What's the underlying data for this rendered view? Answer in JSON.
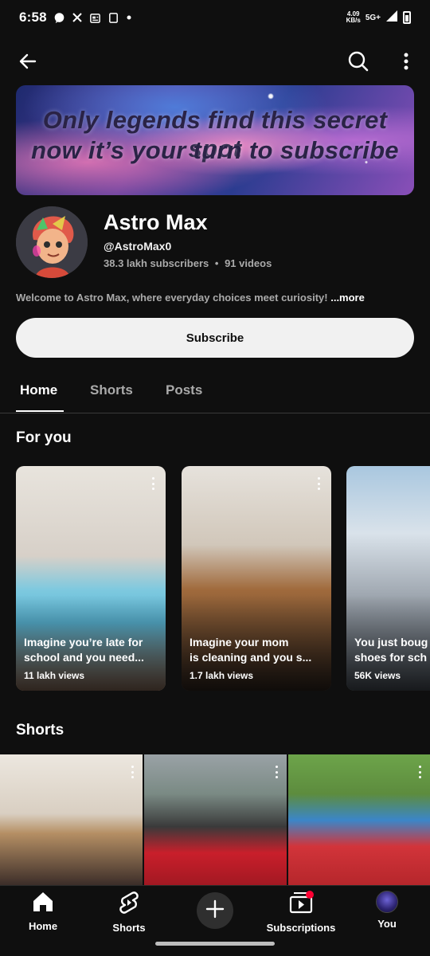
{
  "status_bar": {
    "time": "6:58",
    "net_speed_top": "4.09",
    "net_speed_bottom": "KB/s",
    "network": "5G+",
    "indicators": [
      "whatsapp-icon",
      "x-icon",
      "news-icon",
      "screen-icon",
      "dot-icon"
    ]
  },
  "top_bar": {
    "icons": [
      "back-arrow-icon",
      "search-icon",
      "more-vertical-icon"
    ]
  },
  "banner": {
    "line1": "Only legends find this secret spot",
    "line2": "now it’s your turn to subscribe"
  },
  "channel": {
    "name": "Astro Max",
    "handle": "@AstroMax0",
    "subscribers": "38.3 lakh subscribers",
    "separator": "•",
    "videos": "91 videos",
    "description": "Welcome to Astro Max, where everyday choices meet curiosity! ",
    "more_label": "...more",
    "subscribe_label": "Subscribe"
  },
  "tabs": [
    {
      "label": "Home",
      "active": true
    },
    {
      "label": "Shorts",
      "active": false
    },
    {
      "label": "Posts",
      "active": false
    }
  ],
  "for_you": {
    "title": "For you",
    "cards": [
      {
        "line1": "Imagine you’re late for",
        "line2": "school and you need...",
        "views": "11 lakh views"
      },
      {
        "line1": "Imagine your mom",
        "line2": "is cleaning and you s...",
        "views": "1.7 lakh views"
      },
      {
        "line1": "You just boug",
        "line2": "shoes for sch",
        "views": "56K views"
      }
    ]
  },
  "shorts": {
    "title": "Shorts"
  },
  "bottom_nav": {
    "items": [
      {
        "label": "Home",
        "icon": "home-icon"
      },
      {
        "label": "Shorts",
        "icon": "shorts-icon"
      },
      {
        "label": "Subscriptions",
        "icon": "subscriptions-icon"
      },
      {
        "label": "You",
        "icon": "you-avatar-icon"
      }
    ],
    "create_icon": "plus-icon",
    "accent": "#ff0033"
  },
  "colors": {
    "background": "#0f0f0f",
    "secondary_text": "#aaaaaa",
    "subscribe_bg": "#f1f1f1"
  }
}
